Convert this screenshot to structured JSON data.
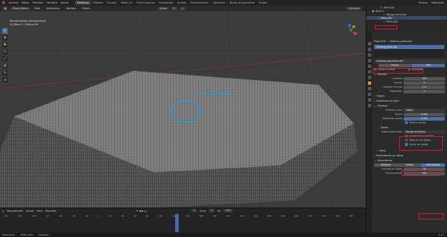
{
  "menu": [
    "Archivo",
    "Editar",
    "Procesar",
    "Ventana",
    "Ayuda"
  ],
  "workspaces": [
    {
      "label": "Modelado",
      "active": true
    },
    {
      "label": "Modelar"
    },
    {
      "label": "Esculpir"
    },
    {
      "label": "Editar UV"
    },
    {
      "label": "Pintar texturas"
    },
    {
      "label": "Sombreado"
    },
    {
      "label": "Animar"
    },
    {
      "label": "Procesamiento"
    },
    {
      "label": "Componer"
    },
    {
      "label": "Nodos de geometría"
    },
    {
      "label": "Scripts"
    }
  ],
  "scene": {
    "label": "Escena",
    "viewlayer": "ViewLayer"
  },
  "header": {
    "mode": "Modo Objeto",
    "view": "Vista",
    "add": "Seleccionar",
    "add2": "Agregar",
    "object": "Objeto",
    "orient": "Global",
    "options": "Opciones"
  },
  "viewport": {
    "overlay_line1": "Personalizada (perspectiva)",
    "overlay_line2": "(0) Nivel 1 | Plano.001",
    "annotation": "Es diagonal"
  },
  "outliner": {
    "rows": [
      {
        "label": "Área.001",
        "indent": 1
      },
      {
        "label": "Nivel 2",
        "indent": 0
      },
      {
        "label": "Manojo de hierba",
        "indent": 2
      },
      {
        "label": "Plano.001",
        "indent": 1,
        "highlight": true
      },
      {
        "label": "Plano.002",
        "indent": 2
      }
    ]
  },
  "properties": {
    "breadcrumb_obj": "Plano.001",
    "breadcrumb_sys": "Sistema_partículas",
    "system_list_item": "Sistema_partículas",
    "settings_name": "Opciones_partículas.001",
    "type_emitter": "Emisor",
    "type_hair": "Pelo",
    "regrow": "Volver a crecer",
    "advanced": "Avanzado",
    "emission": "Emisión",
    "number_label": "Cantidad",
    "number": "200",
    "seed_label": "Semilla",
    "seed": "0",
    "hair_length_label": "Longitud del pelo",
    "hair_length": "4 m",
    "segments_label": "Segmentos",
    "segments": "5",
    "source": "Origen",
    "hair_dynamics": "Dinámicas de pelo",
    "render": "Procesar",
    "render_as_label": "Procesar como",
    "render_as": "Objeto",
    "scale_label": "Escala",
    "scale": "0.040",
    "scale_rand_label": "Aleatorizar escala",
    "scale_rand": "0.315",
    "show_emitter": "Mostrar emisor",
    "object_sec": "Objeto",
    "instance_obj_label": "Objeto instanciado",
    "instance_obj": "Manojo de hierba",
    "global_coords": "Coordenadas globales",
    "obj_rotation": "Rotación del objeto",
    "obj_scale": "Escala del objeto",
    "extra": "Otros",
    "viewport_display": "Presentación en vistas",
    "children": "Secundarias",
    "child_none": "Ninguno",
    "child_simple": "Simple",
    "child_interp": "Interpoladas",
    "display_amount_label": "Cantidad en Vistas",
    "display_amount": "30",
    "render_amount_label": "Procesamiento",
    "render_amount": "100"
  },
  "timeline": {
    "playback": "Reproducción",
    "keying": "Claves",
    "view": "Vista",
    "marker": "Marcador",
    "start_label": "Inicio",
    "start": "1",
    "end_label": "Fin",
    "end": "250",
    "current": "1",
    "ticks": [
      "-140",
      "-120",
      "-100",
      "-80",
      "-60",
      "-40",
      "-20",
      "0",
      "20",
      "40",
      "60",
      "80",
      "100",
      "120",
      "140",
      "160",
      "180",
      "200",
      "220",
      "240",
      "260",
      "280",
      "300",
      "320",
      "340",
      "360",
      "380"
    ]
  },
  "status": {
    "select": "Seleccionar",
    "rotate": "Rotar vista",
    "options": "Opciones",
    "version": "4.4.3"
  }
}
